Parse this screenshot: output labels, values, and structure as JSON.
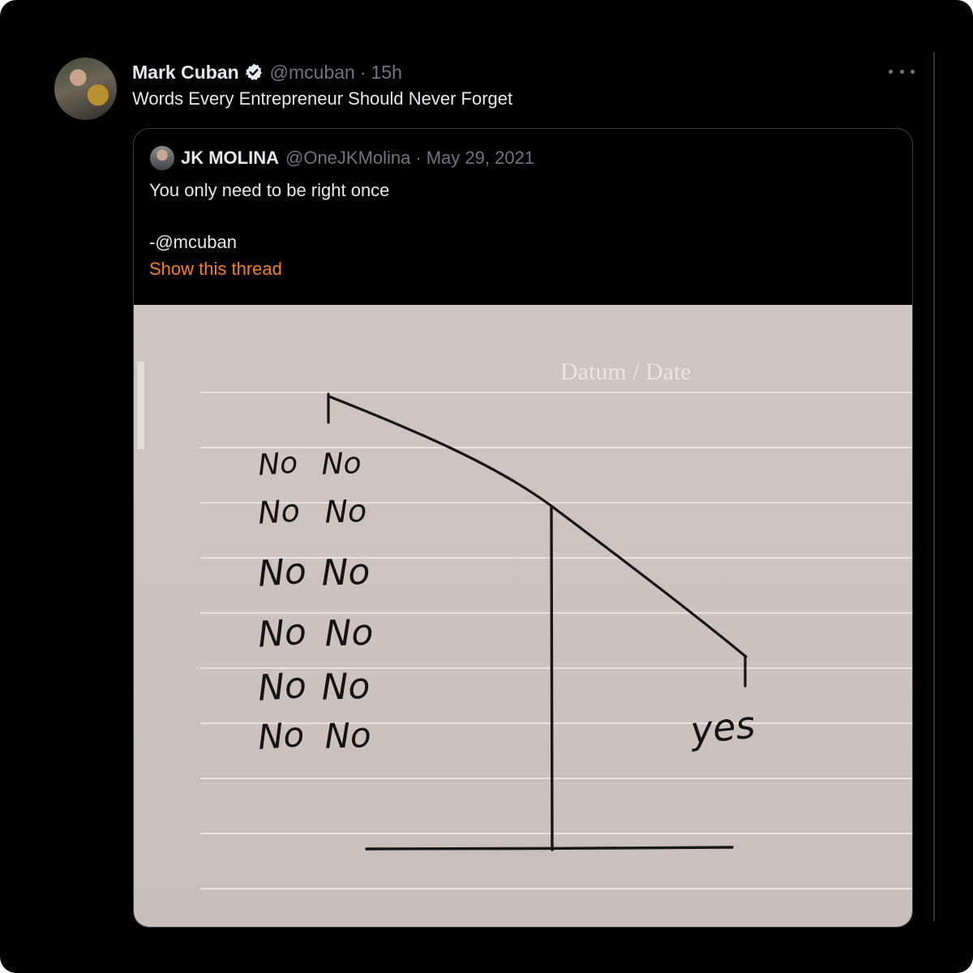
{
  "tweet": {
    "author_name": "Mark Cuban",
    "handle": "@mcuban",
    "separator": "·",
    "time": "15h",
    "text": "Words Every Entrepreneur Should Never Forget"
  },
  "quoted_tweet": {
    "author_name": "JK MOLINA",
    "handle": "@OneJKMolina",
    "separator": "·",
    "date": "May 29, 2021",
    "text": "You only need to be right once\n\n-@mcuban",
    "show_thread_label": "Show this thread"
  },
  "drawing": {
    "paper_header": "Datum / Date",
    "no_rows": [
      [
        "No",
        "No"
      ],
      [
        "No",
        "No"
      ],
      [
        "No",
        "No"
      ],
      [
        "No",
        "No"
      ],
      [
        "No",
        "No"
      ],
      [
        "No",
        "No"
      ]
    ],
    "yes_label": "yes"
  },
  "icons": {
    "verified": "verified-badge-icon",
    "more": "more-options-icon"
  },
  "colors": {
    "background": "#000000",
    "primary_text": "#e7e9ea",
    "secondary_text": "#71767b",
    "link_accent": "#f4801f",
    "border": "#3a3f44",
    "paper": "#cfc6c1",
    "ink": "#161616"
  }
}
